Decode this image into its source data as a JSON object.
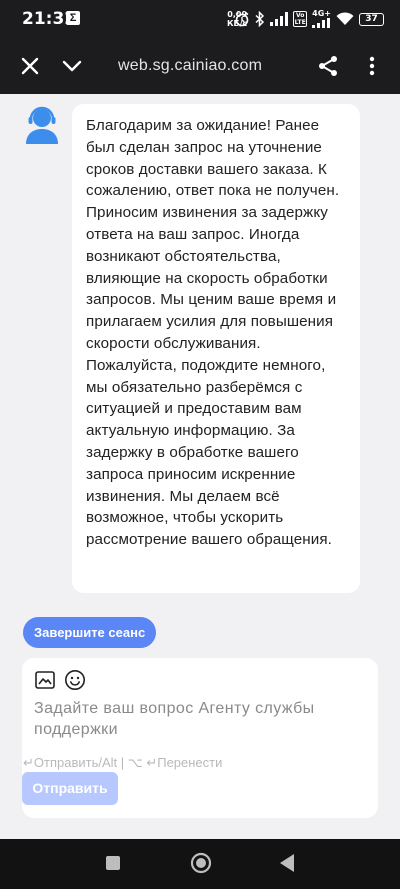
{
  "status_bar": {
    "time": "21:32",
    "app_icon": "Σ",
    "speed_value": "0,09",
    "speed_unit": "КБ/с",
    "network": "4G+",
    "volte": "Vo LTE",
    "battery": "37",
    "icons": [
      "alarm-icon",
      "bluetooth-icon",
      "signal-icon",
      "wifi-icon"
    ]
  },
  "browser": {
    "url": "web.sg.cainiao.com",
    "icons": [
      "close-icon",
      "chevron-down-icon",
      "share-icon",
      "more-vert-icon"
    ]
  },
  "chat": {
    "agent_message": "Благодарим за ожидание! Ранее был сделан запрос на уточнение сроков доставки вашего заказа. К сожалению, ответ пока не получен. Приносим извинения за задержку ответа на ваш запрос. Иногда возникают обстоятельства, влияющие на скорость обработки запросов. Мы ценим ваше время и прилагаем усилия для повышения скорости обслуживания. Пожалуйста, подождите немного, мы обязательно разберёмся с ситуацией и предоставим вам актуальную информацию. За задержку в обработке вашего запроса приносим искренние извинения. Мы делаем всё возможное, чтобы ускорить рассмотрение вашего обращения.",
    "end_session_label": "Завершите сеанс"
  },
  "composer": {
    "placeholder": "Задайте ваш вопрос Агенту службы поддержки",
    "shortcut_hint": "↵Отправить/Alt | ⌥ ↵Перенести",
    "send_label": "Отправить"
  },
  "colors": {
    "accent": "#5b86f5",
    "send_disabled": "#b6c8ff",
    "avatar": "#3d8eec",
    "dark_bar": "#1c1c1e"
  }
}
